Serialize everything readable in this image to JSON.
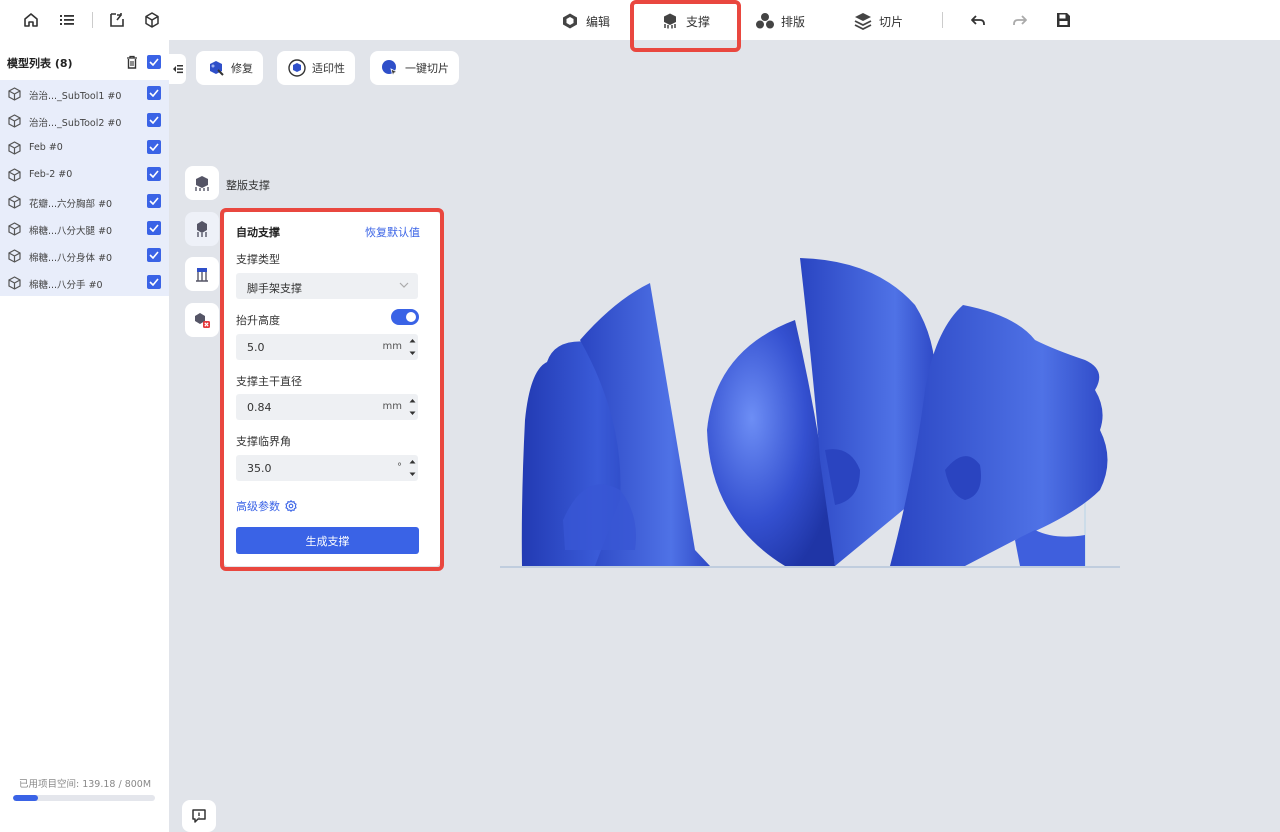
{
  "topbar": {
    "left_icons": [
      "home-icon",
      "list-icon",
      "import-icon",
      "model-icon"
    ],
    "tabs": [
      {
        "label": "编辑",
        "icon": "edit-cube-icon"
      },
      {
        "label": "支撑",
        "icon": "support-icon",
        "active": true
      },
      {
        "label": "排版",
        "icon": "layout-icon"
      },
      {
        "label": "切片",
        "icon": "slice-layers-icon"
      }
    ],
    "right_icons": [
      "undo-icon",
      "redo-icon",
      "save-icon"
    ]
  },
  "sidebar": {
    "title": "模型列表 (8)",
    "items": [
      {
        "label": "治治..._SubTool1 #0",
        "checked": true
      },
      {
        "label": "治治..._SubTool2 #0",
        "checked": true
      },
      {
        "label": "Feb #0",
        "checked": true
      },
      {
        "label": "Feb-2 #0",
        "checked": true
      },
      {
        "label": "花瓣...六分胸部 #0",
        "checked": true
      },
      {
        "label": "棉糖...八分大腿 #0",
        "checked": true
      },
      {
        "label": "棉糖...八分身体 #0",
        "checked": true
      },
      {
        "label": "棉糖...八分手 #0",
        "checked": true
      }
    ],
    "storage": {
      "label": "已用项目空间: 139.18 / 800M",
      "used": 139.18,
      "total": 800
    }
  },
  "actions": [
    {
      "label": "修复",
      "icon": "repair-icon"
    },
    {
      "label": "适印性",
      "icon": "printability-icon"
    },
    {
      "label": "一键切片",
      "icon": "one-click-slice-icon"
    }
  ],
  "tools": {
    "first_label": "整版支撑"
  },
  "panel": {
    "title": "自动支撑",
    "reset": "恢复默认值",
    "support_type_label": "支撑类型",
    "support_type_value": "脚手架支撑",
    "lift_label": "抬升高度",
    "lift_enabled": true,
    "lift_value": "5.0",
    "lift_unit": "mm",
    "trunk_label": "支撑主干直径",
    "trunk_value": "0.84",
    "trunk_unit": "mm",
    "angle_label": "支撑临界角",
    "angle_value": "35.0",
    "angle_unit": "°",
    "advanced": "高级参数",
    "generate": "生成支撑"
  },
  "colors": {
    "accent": "#3a63e6",
    "highlight": "#e9473f",
    "model": "#2c47c4"
  }
}
